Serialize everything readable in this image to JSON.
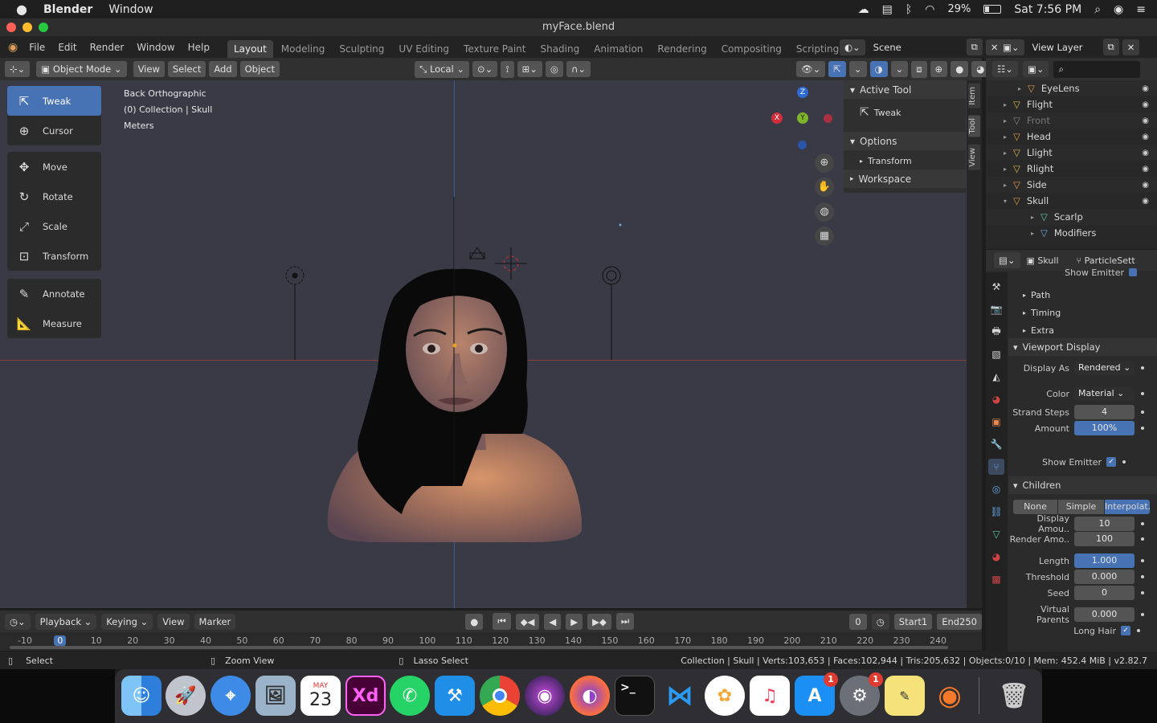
{
  "menubar": {
    "app": "Blender",
    "items": [
      "Window"
    ],
    "battery": "29%",
    "clock": "Sat 7:56 PM"
  },
  "window": {
    "title": "myFace.blend"
  },
  "topbar": {
    "menus": [
      "File",
      "Edit",
      "Render",
      "Window",
      "Help"
    ],
    "workspaces": [
      "Layout",
      "Modeling",
      "Sculpting",
      "UV Editing",
      "Texture Paint",
      "Shading",
      "Animation",
      "Rendering",
      "Compositing",
      "Scripting"
    ],
    "scene": "Scene",
    "view_layer": "View Layer"
  },
  "viewport_header": {
    "mode": "Object Mode",
    "menus": [
      "View",
      "Select",
      "Add",
      "Object"
    ],
    "orientation": "Local"
  },
  "viewport": {
    "info_lines": [
      "Back Orthographic",
      "(0) Collection | Skull",
      "Meters"
    ],
    "tools_group1": [
      "Tweak",
      "Cursor"
    ],
    "tools_group2": [
      "Move",
      "Rotate",
      "Scale",
      "Transform"
    ],
    "tools_group3": [
      "Annotate",
      "Measure"
    ],
    "gizmo_axes": {
      "z": "Z",
      "y": "Y",
      "x": "X"
    }
  },
  "npanel": {
    "active_tool": "Active Tool",
    "tool_name": "Tweak",
    "options": "Options",
    "transform": "Transform",
    "workspace": "Workspace",
    "tabs": [
      "Item",
      "Tool",
      "View"
    ]
  },
  "outliner": {
    "rows": [
      {
        "name": "EyeLens",
        "color": "#e09a4a"
      },
      {
        "name": "Flight",
        "color": "#e0b050"
      },
      {
        "name": "Front",
        "color": "#888888"
      },
      {
        "name": "Head",
        "color": "#e09a4a"
      },
      {
        "name": "Llight",
        "color": "#e0b050"
      },
      {
        "name": "Rlight",
        "color": "#e0b050"
      },
      {
        "name": "Side",
        "color": "#e09a4a"
      },
      {
        "name": "Skull",
        "color": "#e09a4a"
      },
      {
        "name": "Scarlp",
        "color": "#5ec7a0"
      },
      {
        "name": "Modifiers",
        "color": "#6aa6e6"
      }
    ]
  },
  "properties": {
    "object": "Skull",
    "particles": "ParticleSett",
    "partial_top": "Show Emitter",
    "sub_sections": [
      "Path",
      "Timing",
      "Extra"
    ],
    "viewport_display": "Viewport Display",
    "display_as_label": "Display As",
    "display_as": "Rendered",
    "color_label": "Color",
    "color": "Material",
    "strand_steps_label": "Strand Steps",
    "strand_steps": "4",
    "amount_label": "Amount",
    "amount": "100%",
    "show_emitter_label": "Show Emitter",
    "children": "Children",
    "children_modes": [
      "None",
      "Simple",
      "Interpolat.."
    ],
    "display_amount_label": "Display Amou..",
    "display_amount": "10",
    "render_amount_label": "Render Amo..",
    "render_amount": "100",
    "length_label": "Length",
    "length": "1.000",
    "threshold_label": "Threshold",
    "threshold": "0.000",
    "seed_label": "Seed",
    "seed": "0",
    "virtual_parents_label": "Virtual Parents",
    "virtual_parents": "0.000",
    "long_hair_label": "Long Hair"
  },
  "timeline": {
    "menus": [
      "Playback",
      "Keying",
      "View",
      "Marker"
    ],
    "current_frame": "0",
    "start_label": "Start",
    "start": "1",
    "end_label": "End",
    "end": "250",
    "ruler": [
      "-10",
      "0",
      "10",
      "20",
      "30",
      "40",
      "50",
      "60",
      "70",
      "80",
      "90",
      "100",
      "110",
      "120",
      "130",
      "140",
      "150",
      "160",
      "170",
      "180",
      "190",
      "200",
      "210",
      "220",
      "230",
      "240"
    ]
  },
  "status": {
    "select": "Select",
    "zoom": "Zoom View",
    "lasso": "Lasso Select",
    "stats": "Collection | Skull | Verts:103,653 | Faces:102,944 | Tris:205,632 | Objects:0/10 | Mem: 452.4 MiB | v2.82.7"
  },
  "dock": {
    "calendar_month": "MAY",
    "calendar_day": "23",
    "xd": "Xd",
    "badge_appstore": "1",
    "badge_prefs": "1"
  }
}
